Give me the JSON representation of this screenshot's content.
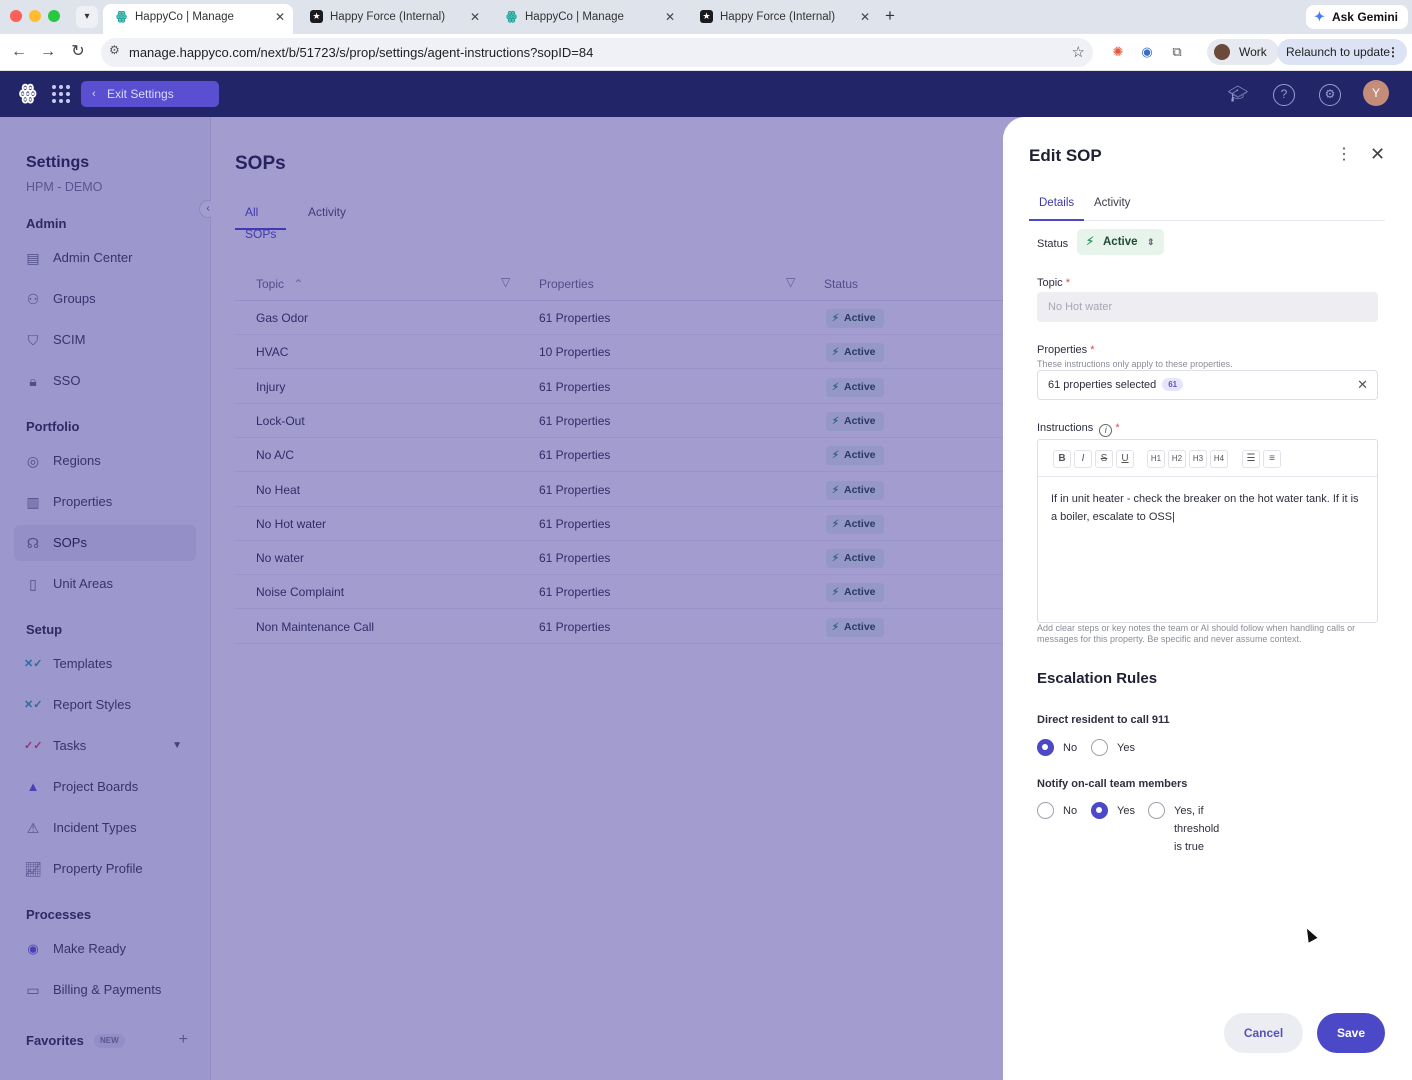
{
  "browser": {
    "tabs": [
      {
        "title": "HappyCo | Manage",
        "favicon": "happyco-logo-icon",
        "active": true
      },
      {
        "title": "Happy Force (Internal)",
        "favicon": "happy-force-icon",
        "active": false
      },
      {
        "title": "HappyCo | Manage",
        "favicon": "happyco-logo-icon",
        "active": false
      },
      {
        "title": "Happy Force (Internal)",
        "favicon": "happy-force-icon",
        "active": false
      }
    ],
    "url": "manage.happyco.com/next/b/51723/s/prop/settings/agent-instructions?sopID=84",
    "ask_gemini": "Ask Gemini",
    "profile": "Work",
    "relaunch": "Relaunch to update"
  },
  "app_header": {
    "exit_settings": "Exit Settings",
    "avatar_initial": "Y"
  },
  "sidebar": {
    "title": "Settings",
    "subtitle": "HPM - DEMO",
    "sections": [
      {
        "heading": "Admin",
        "items": [
          {
            "label": "Admin Center",
            "icon": "building-icon"
          },
          {
            "label": "Groups",
            "icon": "users-icon"
          },
          {
            "label": "SCIM",
            "icon": "scim-icon"
          },
          {
            "label": "SSO",
            "icon": "lock-icon"
          }
        ]
      },
      {
        "heading": "Portfolio",
        "items": [
          {
            "label": "Regions",
            "icon": "map-pin-icon"
          },
          {
            "label": "Properties",
            "icon": "property-icon"
          },
          {
            "label": "SOPs",
            "icon": "headset-icon",
            "active": true
          },
          {
            "label": "Unit Areas",
            "icon": "door-icon"
          }
        ]
      },
      {
        "heading": "Setup",
        "items": [
          {
            "label": "Templates",
            "icon": "templates-icon"
          },
          {
            "label": "Report Styles",
            "icon": "report-styles-icon"
          },
          {
            "label": "Tasks",
            "icon": "tasks-icon"
          },
          {
            "label": "Project Boards",
            "icon": "project-boards-icon"
          },
          {
            "label": "Incident Types",
            "icon": "warning-icon"
          },
          {
            "label": "Property Profile",
            "icon": "chart-icon"
          }
        ]
      },
      {
        "heading": "Processes",
        "items": [
          {
            "label": "Make Ready",
            "icon": "make-ready-icon"
          },
          {
            "label": "Billing & Payments",
            "icon": "card-icon"
          }
        ]
      }
    ],
    "favorites": "Favorites",
    "new_badge": "NEW"
  },
  "main": {
    "title": "SOPs",
    "tabs": [
      "All SOPs",
      "Activity"
    ],
    "columns": [
      "Topic",
      "Properties",
      "Status"
    ],
    "rows": [
      {
        "topic": "Gas Odor",
        "properties": "61 Properties",
        "status": "Active"
      },
      {
        "topic": "HVAC",
        "properties": "10 Properties",
        "status": "Active"
      },
      {
        "topic": "Injury",
        "properties": "61 Properties",
        "status": "Active"
      },
      {
        "topic": "Lock-Out",
        "properties": "61 Properties",
        "status": "Active"
      },
      {
        "topic": "No A/C",
        "properties": "61 Properties",
        "status": "Active"
      },
      {
        "topic": "No Heat",
        "properties": "61 Properties",
        "status": "Active"
      },
      {
        "topic": "No Hot water",
        "properties": "61 Properties",
        "status": "Active"
      },
      {
        "topic": "No water",
        "properties": "61 Properties",
        "status": "Active"
      },
      {
        "topic": "Noise Complaint",
        "properties": "61 Properties",
        "status": "Active"
      },
      {
        "topic": "Non Maintenance Call",
        "properties": "61 Properties",
        "status": "Active"
      }
    ]
  },
  "panel": {
    "title": "Edit SOP",
    "tabs": [
      "Details",
      "Activity"
    ],
    "status_label": "Status",
    "status_value": "Active",
    "topic_label": "Topic",
    "topic_placeholder": "No Hot water",
    "properties_label": "Properties",
    "properties_hint": "These instructions only apply to these properties.",
    "properties_value": "61 properties selected",
    "properties_count": "61",
    "instructions_label": "Instructions",
    "editor_tools": [
      "B",
      "I",
      "S",
      "U",
      "H1",
      "H2",
      "H3",
      "H4",
      "bullet-list",
      "numbered-list"
    ],
    "instructions_text": "If in unit heater - check the breaker on the hot water tank. If it is a boiler, escalate to OSS|",
    "instructions_hint": "Add clear steps or key notes the team or AI should follow when handling calls or messages for this property. Be specific and never assume context.",
    "escalation_title": "Escalation Rules",
    "call_911_label": "Direct resident to call 911",
    "call_911_options": [
      {
        "label": "No",
        "selected": true
      },
      {
        "label": "Yes",
        "selected": false
      }
    ],
    "notify_label": "Notify on-call team members",
    "notify_options": [
      {
        "label": "No",
        "selected": false
      },
      {
        "label": "Yes",
        "selected": true
      },
      {
        "label": "Yes, if threshold is true",
        "selected": false
      }
    ],
    "cancel": "Cancel",
    "save": "Save"
  },
  "colors": {
    "header": "#232569",
    "accent": "#4c49c8",
    "overlay": "#3428964a",
    "status_green": "#2e9a62"
  }
}
